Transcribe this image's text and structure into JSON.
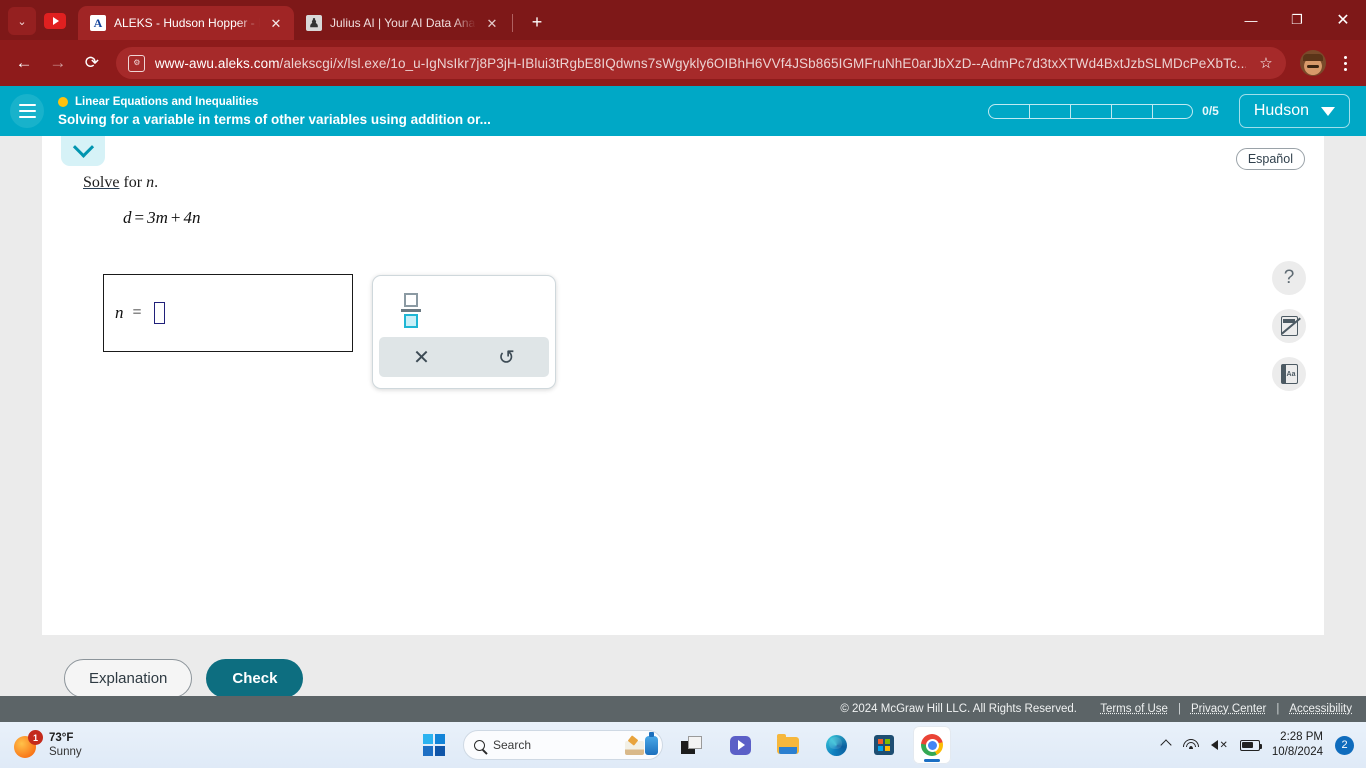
{
  "browser": {
    "tabs": [
      {
        "title": "ALEKS - Hudson Hopper - Lear",
        "favicon_letter": "A",
        "close": "✕",
        "active": true
      },
      {
        "title": "Julius AI | Your AI Data Analyst",
        "favicon_letter": "♟",
        "close": "✕",
        "active": false
      }
    ],
    "new_tab": "+",
    "tab_search": "⌄",
    "window_controls": {
      "minimize": "—",
      "maximize": "❐",
      "close": "✕"
    },
    "nav": {
      "back": "←",
      "forward": "→",
      "reload": "⟳"
    },
    "url_domain": "www-awu.aleks.com",
    "url_path": "/alekscgi/x/lsl.exe/1o_u-IgNsIkr7j8P3jH-IBlui3tRgbE8IQdwns7sWgykly6OIBhH6VVf4JSb865IGMFruNhE0arJbXzD--AdmPc7d3txXTWd4BxtJzbSLMDcPeXbTc...",
    "site_icon": "tune-icon",
    "bookmark_star": "☆",
    "menu": "kebab-menu"
  },
  "aleks": {
    "topic": "Linear Equations and Inequalities",
    "lesson": "Solving for a variable in terms of other variables using addition or...",
    "progress": {
      "segments": 5,
      "filled": 0,
      "label": "0/5"
    },
    "user": "Hudson",
    "espanol": "Español",
    "question": {
      "prompt_link": "Solve",
      "prompt_rest": " for ",
      "prompt_var": "n",
      "prompt_end": ".",
      "equation_lhs": "d",
      "equation_eq": "=",
      "equation_rhs_1": "3m",
      "equation_plus": "+",
      "equation_rhs_2": "4n"
    },
    "answer": {
      "variable": "n",
      "equals": "=",
      "value": ""
    },
    "palette": {
      "fraction_label": "fraction-button",
      "clear_label": "✕",
      "undo_label": "↺"
    },
    "tools": [
      {
        "name": "help-icon",
        "glyph": "?"
      },
      {
        "name": "calculator-disabled-icon",
        "glyph": ""
      },
      {
        "name": "glossary-icon",
        "glyph": "Aa"
      }
    ],
    "buttons": {
      "explanation": "Explanation",
      "check": "Check"
    },
    "footer": {
      "copyright": "© 2024 McGraw Hill LLC. All Rights Reserved.",
      "links": [
        "Terms of Use",
        "Privacy Center",
        "Accessibility"
      ],
      "separator": "|"
    }
  },
  "taskbar": {
    "weather": {
      "temp": "73°F",
      "condition": "Sunny",
      "badge": "1"
    },
    "search_placeholder": "Search",
    "apps": [
      "task-view",
      "teams",
      "file-explorer",
      "edge",
      "microsoft-store",
      "chrome"
    ],
    "tray": {
      "time": "2:28 PM",
      "date": "10/8/2024",
      "notification_count": "2",
      "volume_muted": "✕"
    }
  },
  "colors": {
    "browser_theme": "#8e1b1b",
    "aleks_teal": "#00a8c6",
    "check_button": "#0d6e80",
    "accent_yellow": "#ffc20e"
  }
}
